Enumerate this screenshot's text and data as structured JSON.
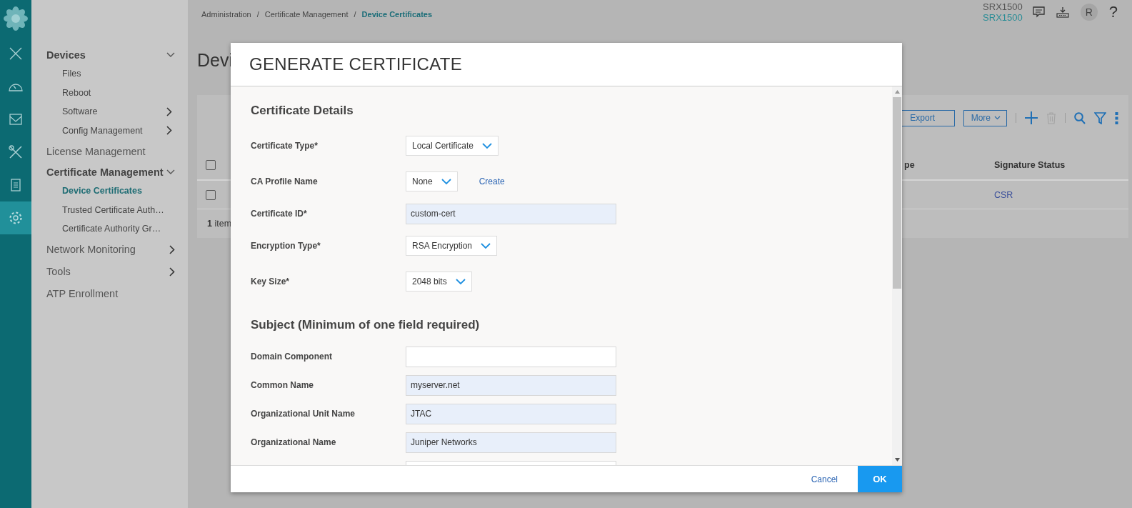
{
  "rail": {
    "items": [
      {
        "selected": false
      },
      {
        "selected": false
      },
      {
        "selected": false
      },
      {
        "selected": false
      },
      {
        "selected": false
      },
      {
        "selected": true
      }
    ]
  },
  "sidebar": {
    "items": [
      {
        "label": "Devices",
        "expanded": true,
        "children": [
          {
            "label": "Files",
            "selected": false
          },
          {
            "label": "Reboot",
            "selected": false
          },
          {
            "label": "Software",
            "selected": false,
            "expanded": false
          },
          {
            "label": "Config Management",
            "selected": false,
            "expanded": false
          }
        ]
      },
      {
        "label": "License Management"
      },
      {
        "label": "Certificate Management",
        "expanded": true,
        "children": [
          {
            "label": "Device Certificates",
            "selected": true
          },
          {
            "label": "Trusted Certificate Auth…",
            "selected": false
          },
          {
            "label": "Certificate Authority Gr…",
            "selected": false
          }
        ]
      },
      {
        "label": "Network Monitoring",
        "expanded": false
      },
      {
        "label": "Tools",
        "expanded": false
      },
      {
        "label": "ATP Enrollment"
      }
    ]
  },
  "breadcrumb": {
    "separator": "/",
    "items": [
      {
        "label": "Administration",
        "selected": false
      },
      {
        "label": "Certificate Management",
        "selected": false
      },
      {
        "label": "Device Certificates",
        "selected": true
      }
    ]
  },
  "header": {
    "device": "SRX1500",
    "device_link": "SRX1500",
    "avatar": "R",
    "help": "?"
  },
  "page": {
    "title": "Devi"
  },
  "table": {
    "toolbar": {
      "buttons": [
        "Export",
        "More"
      ]
    },
    "all_checked": false,
    "columns": [
      "pe",
      "Signature Status"
    ],
    "rows": [
      {
        "checked": false,
        "cells": [
          "",
          "CSR"
        ]
      }
    ],
    "footer": {
      "count": "1",
      "label": "item"
    }
  },
  "dialog": {
    "title": "GENERATE CERTIFICATE",
    "sections": [
      {
        "heading": "Certificate Details",
        "fields": [
          {
            "kind": "select",
            "label": "Certificate Type*",
            "value": "Local Certificate"
          },
          {
            "kind": "select",
            "label": "CA Profile Name",
            "value": "None",
            "link": "Create"
          },
          {
            "kind": "text",
            "label": "Certificate ID*",
            "value": "custom-cert"
          },
          {
            "kind": "select",
            "label": "Encryption Type*",
            "value": "RSA Encryption"
          },
          {
            "kind": "select",
            "label": "Key Size*",
            "value": "2048 bits"
          }
        ]
      },
      {
        "heading": "Subject (Minimum of one field required)",
        "fields": [
          {
            "kind": "text",
            "label": "Domain Component"
          },
          {
            "kind": "text",
            "label": "Common Name",
            "value": "myserver.net"
          },
          {
            "kind": "text",
            "label": "Organizational Unit Name",
            "value": "JTAC"
          },
          {
            "kind": "text",
            "label": "Organizational Name",
            "value": "Juniper Networks"
          },
          {
            "kind": "text"
          }
        ]
      }
    ],
    "buttons": {
      "cancel": "Cancel",
      "ok": "OK"
    }
  }
}
